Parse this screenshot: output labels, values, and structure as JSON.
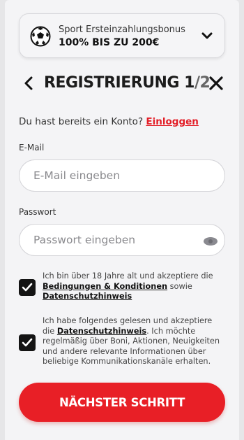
{
  "promo": {
    "title": "Sport Ersteinzahlungsbonus",
    "amount": "100% BIS ZU 200€",
    "icon": "soccer-ball-icon"
  },
  "header": {
    "title_prefix": "REGISTRIERUNG 1",
    "title_suffix": "/2"
  },
  "login": {
    "prompt": "Du hast bereits ein Konto?",
    "link": "Einloggen"
  },
  "email": {
    "label": "E-Mail",
    "placeholder": "E-Mail eingeben",
    "value": ""
  },
  "password": {
    "label": "Passwort",
    "placeholder": "Passwort eingeben",
    "value": ""
  },
  "consents": [
    {
      "checked": true,
      "text_1": "Ich bin über 18 Jahre alt und akzeptiere die",
      "link_1": "Bedingungen & Konditionen",
      "text_2": "sowie",
      "link_2": "Datenschutzhinweis"
    },
    {
      "checked": true,
      "text_1": "Ich habe folgendes gelesen und akzeptiere die",
      "link_1": "Datenschutzhinweis",
      "text_2": ". Ich möchte regelmäßig über Boni, Aktionen, Neuigkeiten und andere relevante Informationen über beliebige Kommunikationskanäle erhalten."
    }
  ],
  "cta": {
    "label": "NÄCHSTER SCHRITT"
  },
  "colors": {
    "accent": "#e81f26",
    "checkbox": "#141414"
  }
}
